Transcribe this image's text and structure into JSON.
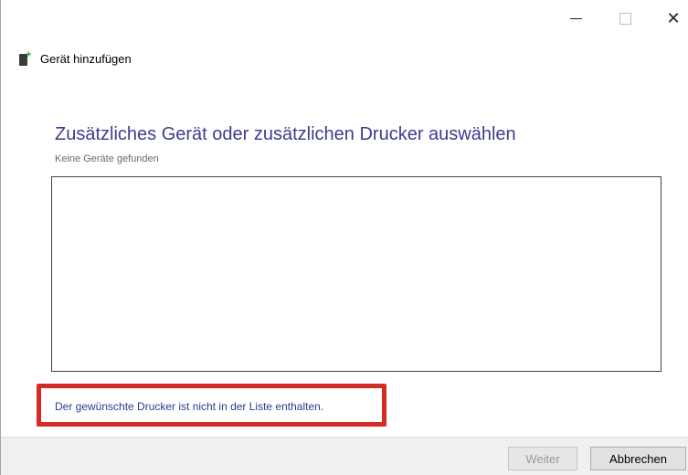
{
  "window": {
    "app_title": "Gerät hinzufügen",
    "controls": {
      "minimize": "minimize-icon",
      "maximize": "maximize-icon",
      "close": "close-icon"
    }
  },
  "main": {
    "heading": "Zusätzliches Gerät oder zusätzlichen Drucker auswählen",
    "status": "Keine Geräte gefunden",
    "device_list": [],
    "printer_not_listed_link": "Der gewünschte Drucker ist nicht in der Liste enthalten."
  },
  "footer": {
    "next_label": "Weiter",
    "cancel_label": "Abbrechen"
  },
  "colors": {
    "heading": "#3b3d8f",
    "link": "#2a3d8c",
    "highlight": "#d52b27"
  }
}
